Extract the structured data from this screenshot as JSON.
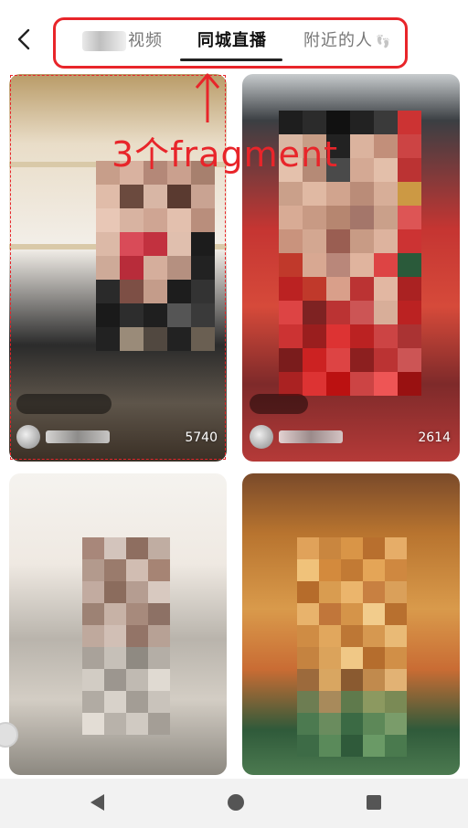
{
  "tabs": {
    "video_label": "视频",
    "city_live_label": "同城直播",
    "nearby_label": "附近的人",
    "nearby_icon": "footprint-icon",
    "active": "同城直播"
  },
  "annotation": {
    "text": "3个fragment",
    "color": "#e8252a"
  },
  "cards": [
    {
      "count": "5740"
    },
    {
      "count": "2614"
    },
    {
      "count": ""
    },
    {
      "count": ""
    }
  ],
  "nav": {
    "back_icon": "triangle-back-icon",
    "home_icon": "circle-home-icon",
    "recent_icon": "square-recent-icon"
  }
}
